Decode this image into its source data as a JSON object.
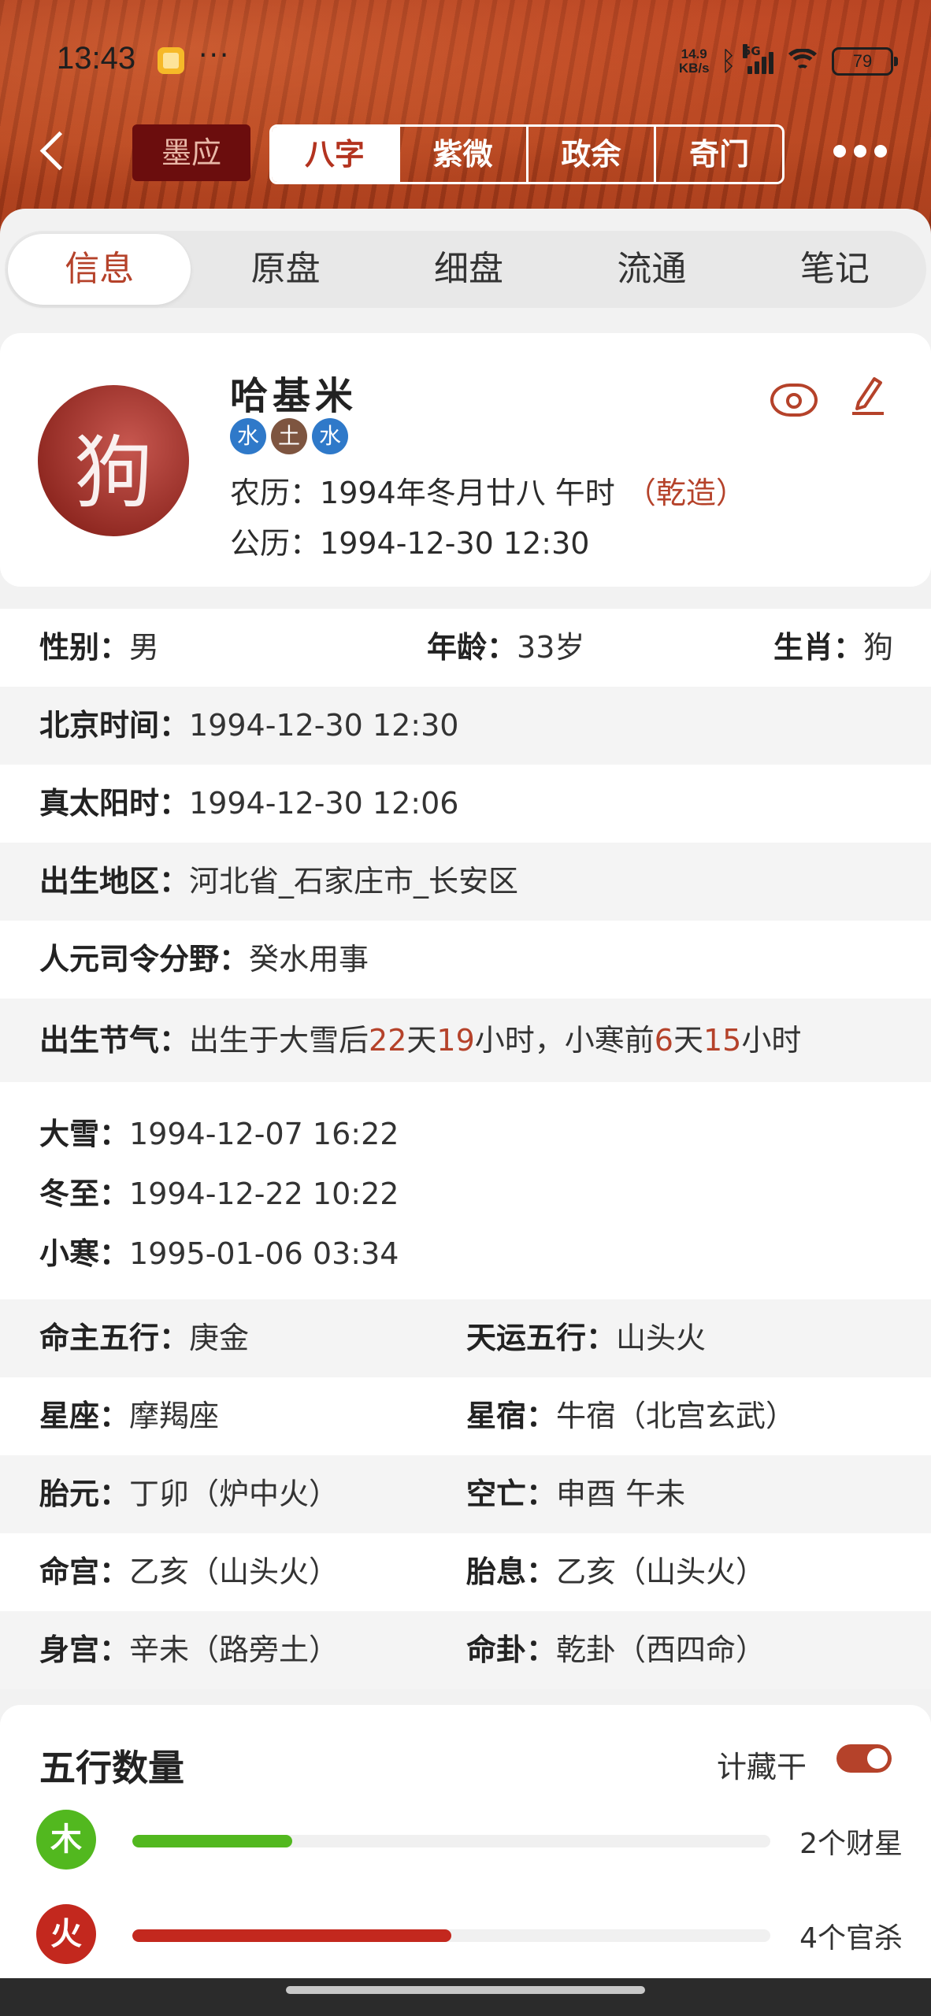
{
  "status_bar": {
    "time": "13:43",
    "more": "···",
    "net_speed_value": "14.9",
    "net_speed_unit": "KB/s",
    "network": "5G",
    "battery": "79"
  },
  "nav": {
    "logo": "墨应",
    "segments": [
      "八字",
      "紫微",
      "政余",
      "奇门"
    ]
  },
  "tabs": [
    "信息",
    "原盘",
    "细盘",
    "流通",
    "笔记"
  ],
  "profile": {
    "name": "哈基米",
    "avatar_char": "狗",
    "badges": [
      {
        "text": "水",
        "color": "#2f79c9"
      },
      {
        "text": "土",
        "color": "#7e5540"
      },
      {
        "text": "水",
        "color": "#2f79c9"
      }
    ],
    "lunar_label": "农历：",
    "lunar_value": "1994年冬月廿八 午时",
    "lunar_tag": "（乾造）",
    "solar_label": "公历：",
    "solar_value": "1994-12-30 12:30"
  },
  "info": {
    "gender_label": "性别：",
    "gender": "男",
    "age_label": "年龄：",
    "age": "33岁",
    "zodiac_label": "生肖：",
    "zodiac": "狗",
    "beijing_label": "北京时间：",
    "beijing": "1994-12-30 12:30",
    "solar_time_label": "真太阳时：",
    "solar_time": "1994-12-30 12:06",
    "region_label": "出生地区：",
    "region": "河北省_石家庄市_长安区",
    "siling_label": "人元司令分野：",
    "siling": "癸水用事",
    "jieqi_label": "出生节气：",
    "jieqi_p1": "出生于大雪后",
    "jieqi_n1": "22",
    "jieqi_p2": "天",
    "jieqi_n2": "19",
    "jieqi_p3": "小时，小寒前",
    "jieqi_n3": "6",
    "jieqi_p4": "天",
    "jieqi_n4": "15",
    "jieqi_p5": "小时",
    "jieqi_list": [
      {
        "label": "大雪：",
        "value": "1994-12-07 16:22"
      },
      {
        "label": "冬至：",
        "value": "1994-12-22 10:22"
      },
      {
        "label": "小寒：",
        "value": "1995-01-06 03:34"
      }
    ],
    "pairs": [
      {
        "l1": "命主五行：",
        "v1": "庚金",
        "l2": "天运五行：",
        "v2": "山头火"
      },
      {
        "l1": "星座：",
        "v1": "摩羯座",
        "l2": "星宿：",
        "v2": "牛宿（北宫玄武）"
      },
      {
        "l1": "胎元：",
        "v1": "丁卯（炉中火）",
        "l2": "空亡：",
        "v2": "申酉 午未"
      },
      {
        "l1": "命宫：",
        "v1": "乙亥（山头火）",
        "l2": "胎息：",
        "v2": "乙亥（山头火）"
      },
      {
        "l1": "身宫：",
        "v1": "辛未（路旁土）",
        "l2": "命卦：",
        "v2": "乾卦（西四命）"
      }
    ]
  },
  "wuxing": {
    "title": "五行数量",
    "toggle_label": "计藏干",
    "toggle_on": true,
    "bars": [
      {
        "element": "木",
        "color": "#52b81f",
        "fraction": 0.25,
        "label": "2个财星"
      },
      {
        "element": "火",
        "color": "#c3281e",
        "fraction": 0.5,
        "label": "4个官杀"
      }
    ]
  }
}
